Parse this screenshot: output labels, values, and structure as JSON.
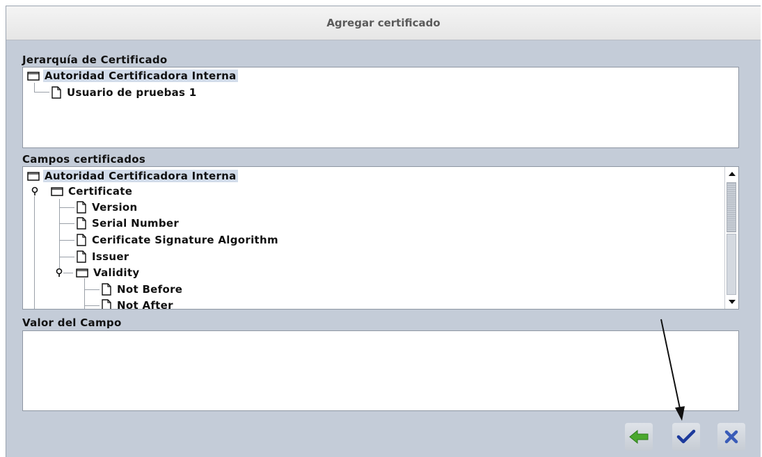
{
  "window": {
    "title": "Agregar certificado"
  },
  "hierarchy": {
    "label": "Jerarquía de Certificado",
    "root": "Autoridad Certificadora Interna",
    "children": [
      "Usuario de pruebas 1"
    ]
  },
  "fields": {
    "label": "Campos certificados",
    "root": "Autoridad Certificadora Interna",
    "certificate": "Certificate",
    "items": [
      "Version",
      "Serial Number",
      "Cerificate Signature Algorithm",
      "Issuer"
    ],
    "validity": "Validity",
    "validity_items": [
      "Not Before",
      "Not After"
    ]
  },
  "value": {
    "label": "Valor del Campo",
    "text": ""
  },
  "toolbar": {
    "buttons": [
      {
        "icon": "back-arrow-icon",
        "color": "#4aa82e"
      },
      {
        "icon": "checkmark-icon",
        "color": "#1c3a9c"
      },
      {
        "icon": "close-x-icon",
        "color": "#3a5cb8"
      }
    ]
  }
}
